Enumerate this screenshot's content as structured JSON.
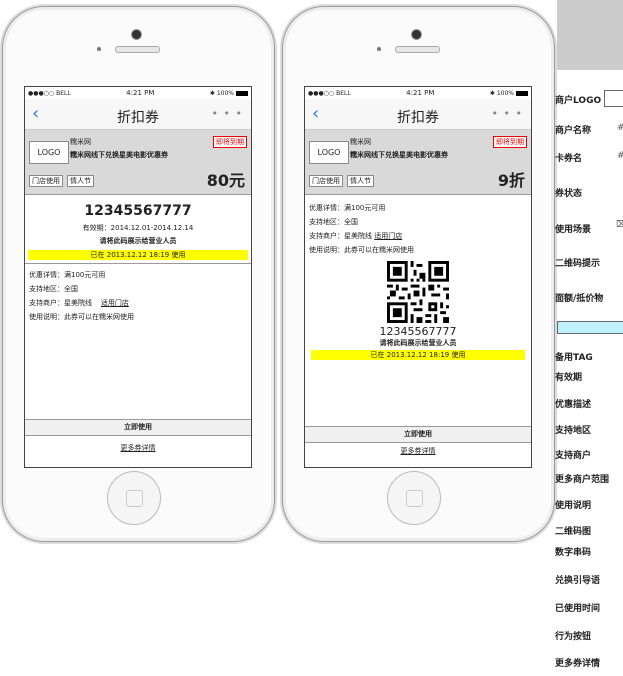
{
  "status_bar": {
    "carrier": "●●●○○ BELL",
    "time": "4:21 PM",
    "battery": "100%"
  },
  "screen_title": "折扣券",
  "more_dots": "• • •",
  "phone1": {
    "logo": "LOGO",
    "merchant": "糯米网",
    "expire_badge": "即将到期",
    "coupon_name": "糯米网线下兑换星美电影优惠券",
    "tags": [
      "门店使用",
      "情人节"
    ],
    "amount": "80元",
    "code": "12345567777",
    "validity": "有效期：2014.12.01-2014.12.14",
    "show_hint": "请将此码展示给营业人员",
    "used_time": "已在 2013.12.12 18:19 使用",
    "details": {
      "discount": "优惠详情：满100元可用",
      "region": "支持地区：全国",
      "merchant_prefix": "支持商户：星美院线",
      "merchant_link": "适用门店",
      "usage": "使用说明：此券可以在糯米网使用"
    },
    "use_button": "立即使用",
    "more_link": "更多券详情"
  },
  "phone2": {
    "logo": "LOGO",
    "merchant": "糯米网",
    "expire_badge": "即将到期",
    "coupon_name": "糯米网线下兑换星美电影优惠券",
    "tags": [
      "门店使用",
      "情人节"
    ],
    "amount": "9折",
    "details": {
      "discount": "优惠详情：满100元可用",
      "region": "支持地区：全国",
      "merchant_prefix": "支持商户：星美院线",
      "merchant_link": "适用门店",
      "usage": "使用说明：此券可以在糯米网使用"
    },
    "code": "12345567777",
    "show_hint": "请将此码展示给营业人员",
    "used_time": "已在 2013.12.12 18:19 使用",
    "use_button": "立即使用",
    "more_link": "更多券详情"
  },
  "properties": [
    "商户LOGO",
    "商户名称",
    "卡券名",
    "券状态",
    "使用场景",
    "二维码提示",
    "面额/抵价物",
    "备用TAG",
    "有效期",
    "优惠描述",
    "支持地区",
    "支持商户",
    "更多商户范围",
    "使用说明",
    "二维码图",
    "数字串码",
    "兑换引导语",
    "已使用时间",
    "行为按钮",
    "更多券详情"
  ],
  "colors": {
    "highlight": "#ffff00",
    "card_gray": "#d9d9d9",
    "link_blue": "#1e7ee0",
    "alert_red": "#e00000",
    "swatch_cyan": "#bff1ff"
  }
}
